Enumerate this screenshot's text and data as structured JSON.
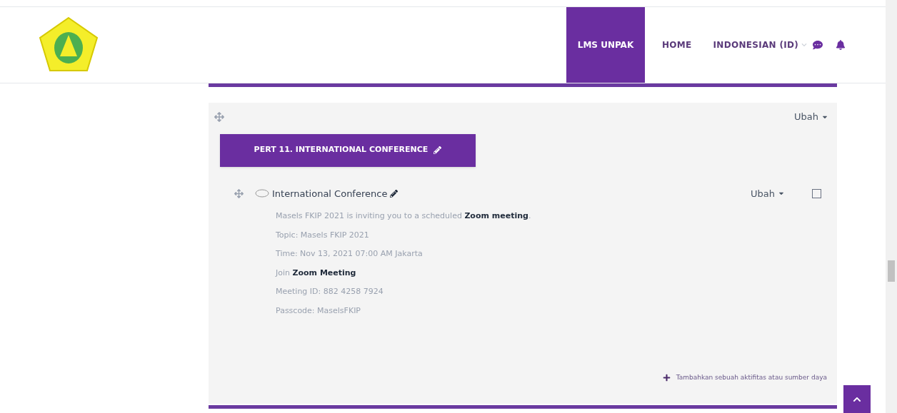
{
  "navbar": {
    "brand": "LMS UNPAK",
    "links": [
      "HOME"
    ],
    "language": "INDONESIAN (ID)"
  },
  "section": {
    "edit_menu": "Ubah",
    "title": "PERT 11. INTERNATIONAL CONFERENCE",
    "activity": {
      "name": "International Conference",
      "edit_menu": "Ubah",
      "completed": false,
      "description": [
        "Masels FKIP 2021 is inviting you to a scheduled **Zoom meeting**.",
        "Topic: Masels FKIP 2021",
        "Time: Nov 13, 2021 07:00 AM Jakarta",
        "Join **Zoom Meeting**",
        "Meeting ID: 882 4258 7924",
        "Passcode: MaselsFKIP"
      ]
    },
    "add_activity": "Tambahkan sebuah aktifitas atau sumber daya"
  }
}
